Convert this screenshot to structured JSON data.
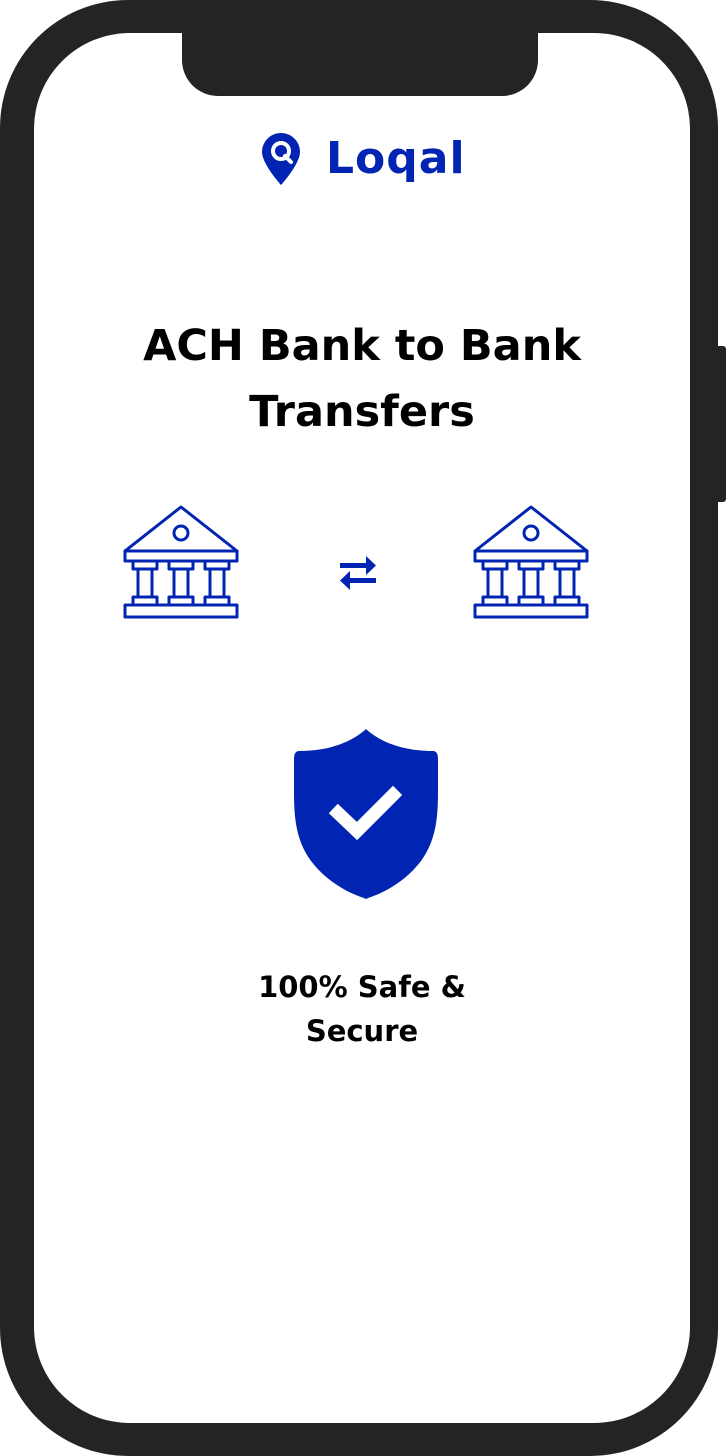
{
  "app": {
    "brand_name": "Loqal",
    "brand_icon": "map-pin-icon"
  },
  "hero": {
    "title": "ACH Bank to Bank Transfers"
  },
  "transfer": {
    "from_icon": "bank-icon",
    "swap_icon": "swap-arrows-icon",
    "to_icon": "bank-icon"
  },
  "security": {
    "icon": "shield-check-icon",
    "label": "100% Safe & Secure"
  },
  "colors": {
    "brand": "#0224b2",
    "frame": "#242424",
    "text": "#000000",
    "screen": "#ffffff"
  }
}
